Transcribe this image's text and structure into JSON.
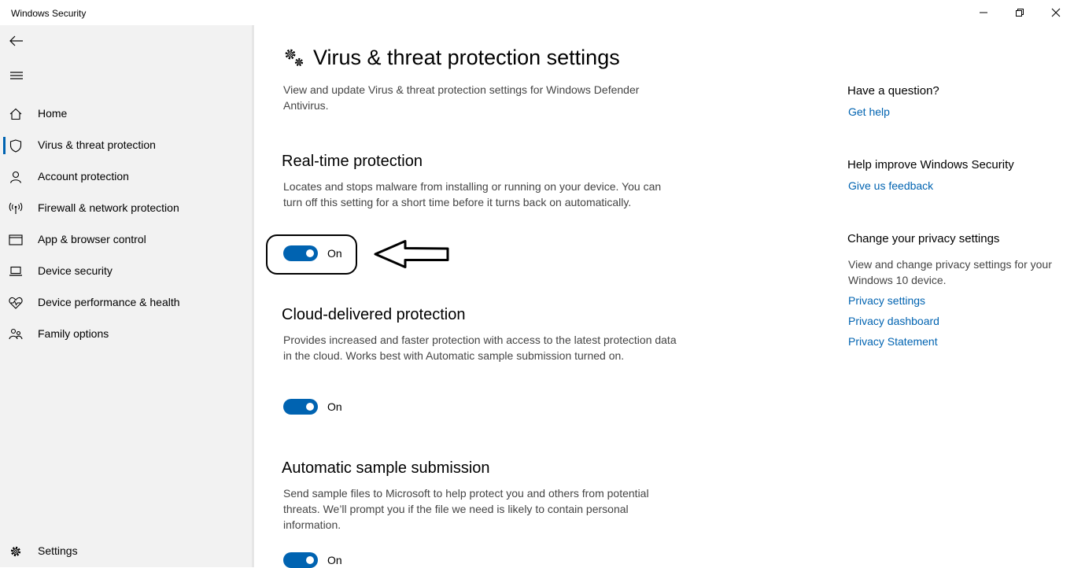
{
  "window": {
    "title": "Windows Security",
    "controls": [
      "minimize-icon",
      "restore-icon",
      "close-icon"
    ]
  },
  "sidebar": {
    "back_icon": "back-arrow-icon",
    "menu_icon": "hamburger-icon",
    "items": [
      {
        "label": "Home",
        "icon": "home-icon",
        "selected": false
      },
      {
        "label": "Virus & threat protection",
        "icon": "shield-icon",
        "selected": true
      },
      {
        "label": "Account protection",
        "icon": "person-icon",
        "selected": false
      },
      {
        "label": "Firewall & network protection",
        "icon": "antenna-icon",
        "selected": false
      },
      {
        "label": "App & browser control",
        "icon": "browser-window-icon",
        "selected": false
      },
      {
        "label": "Device security",
        "icon": "laptop-icon",
        "selected": false
      },
      {
        "label": "Device performance & health",
        "icon": "heart-pulse-icon",
        "selected": false
      },
      {
        "label": "Family options",
        "icon": "family-icon",
        "selected": false
      }
    ],
    "settings_label": "Settings",
    "settings_icon": "gear-icon"
  },
  "main": {
    "title": "Virus & threat protection settings",
    "title_icon": "gears-icon",
    "description": "View and update Virus & threat protection settings for Windows Defender Antivirus.",
    "sections": [
      {
        "title": "Real-time protection",
        "description": "Locates and stops malware from installing or running on your device. You can turn off this setting for a short time before it turns back on automatically.",
        "toggle_state": "On",
        "toggle_on": true
      },
      {
        "title": "Cloud-delivered protection",
        "description": "Provides increased and faster protection with access to the latest protection data in the cloud. Works best with Automatic sample submission turned on.",
        "toggle_state": "On",
        "toggle_on": true
      },
      {
        "title": "Automatic sample submission",
        "description": "Send sample files to Microsoft to help protect you and others from potential threats. We’ll prompt you if the file we need is likely to contain personal information.",
        "toggle_state": "On",
        "toggle_on": true
      }
    ]
  },
  "right_panel": {
    "question_heading": "Have a question?",
    "get_help_link": "Get help",
    "improve_heading": "Help improve Windows Security",
    "feedback_link": "Give us feedback",
    "privacy_heading": "Change your privacy settings",
    "privacy_text": "View and change privacy settings for your Windows 10 device.",
    "privacy_links": [
      "Privacy settings",
      "Privacy dashboard",
      "Privacy Statement"
    ]
  },
  "annotations": {
    "highlight": "hand-drawn-box-around-realtime-toggle",
    "arrow": "hand-drawn-arrow-pointing-left"
  },
  "colors": {
    "accent": "#0063b1",
    "sidebar_bg": "#f2f2f2",
    "body_text": "#444444"
  }
}
